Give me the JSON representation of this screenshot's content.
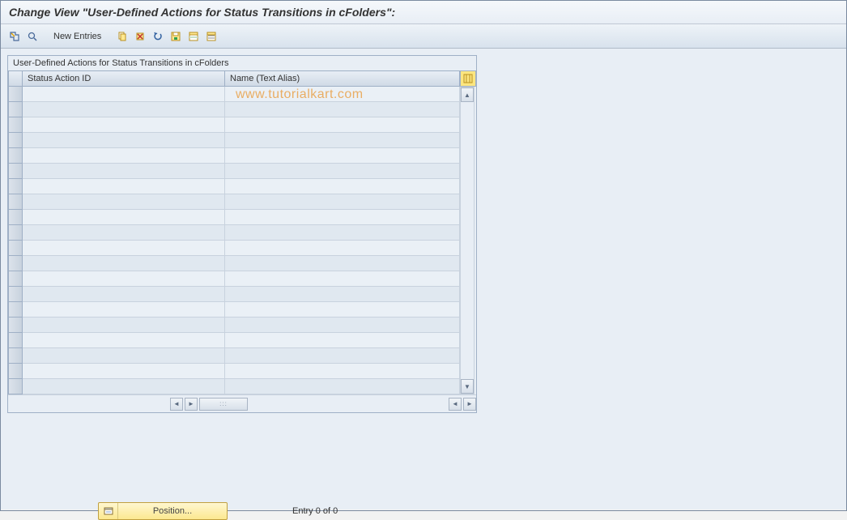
{
  "title": "Change View \"User-Defined Actions for Status Transitions in cFolders\":",
  "toolbar": {
    "new_entries": "New Entries"
  },
  "panel": {
    "title": "User-Defined Actions for Status Transitions in cFolders",
    "columns": {
      "col1": "Status Action ID",
      "col2": "Name (Text Alias)"
    }
  },
  "footer": {
    "position": "Position...",
    "entry": "Entry 0 of 0"
  },
  "watermark": "www.tutorialkart.com"
}
